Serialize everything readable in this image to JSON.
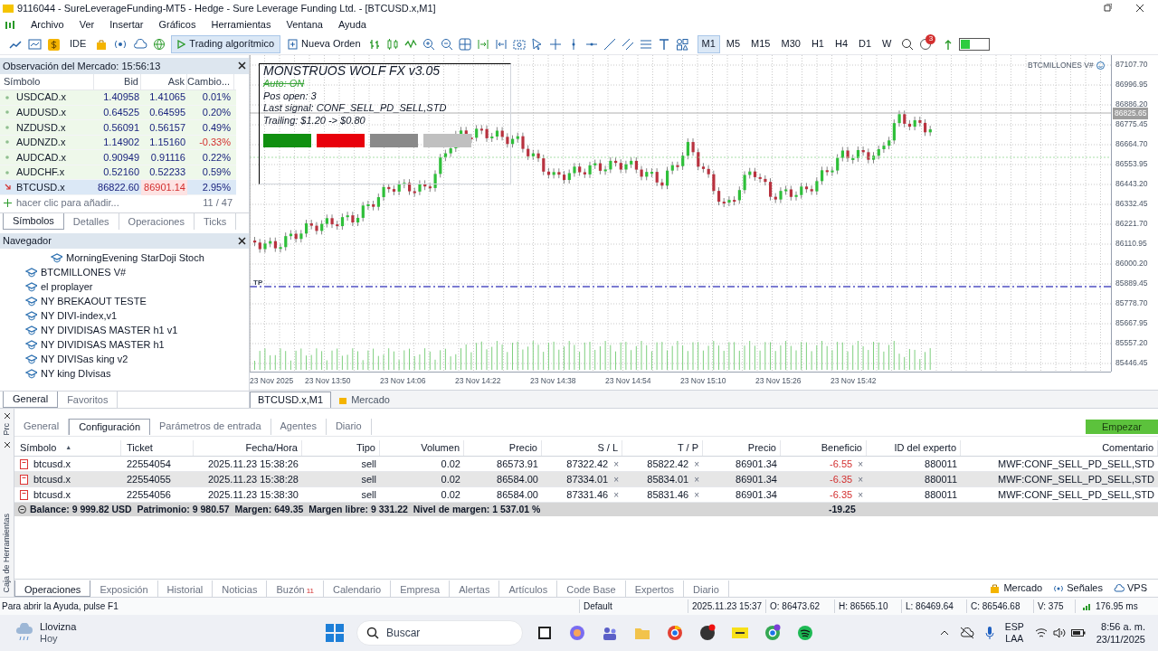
{
  "window": {
    "title": "9116044 - SureLeverageFunding-MT5 - Hedge - Sure Leverage Funding Ltd. - [BTCUSD.x,M1]"
  },
  "menu": [
    "Archivo",
    "Ver",
    "Insertar",
    "Gráficos",
    "Herramientas",
    "Ventana",
    "Ayuda"
  ],
  "toolbar": {
    "ide": "IDE",
    "algo_trading": {
      "label": "Trading algorítmico",
      "on": true
    },
    "new_order": "Nueva Orden",
    "timeframes": [
      {
        "label": "M1",
        "selected": true
      },
      {
        "label": "M5",
        "selected": false
      },
      {
        "label": "M15",
        "selected": false
      },
      {
        "label": "M30",
        "selected": false
      },
      {
        "label": "H1",
        "selected": false
      },
      {
        "label": "H4",
        "selected": false
      },
      {
        "label": "D1",
        "selected": false
      },
      {
        "label": "W",
        "selected": false
      }
    ],
    "notification_count": "3"
  },
  "market_watch": {
    "title": "Observación del Mercado: 15:56:13",
    "columns": [
      "Símbolo",
      "Bid",
      "Ask",
      "Cambio..."
    ],
    "rows": [
      {
        "symbol": "USDCAD.x",
        "bid": "1.40958",
        "ask": "1.41065",
        "change": "0.01%",
        "kind": "flat",
        "negative": false,
        "ask_falling": false,
        "selected": false
      },
      {
        "symbol": "AUDUSD.x",
        "bid": "0.64525",
        "ask": "0.64595",
        "change": "0.20%",
        "kind": "flat",
        "negative": false,
        "ask_falling": false,
        "selected": false
      },
      {
        "symbol": "NZDUSD.x",
        "bid": "0.56091",
        "ask": "0.56157",
        "change": "0.49%",
        "kind": "flat",
        "negative": false,
        "ask_falling": false,
        "selected": false
      },
      {
        "symbol": "AUDNZD.x",
        "bid": "1.14902",
        "ask": "1.15160",
        "change": "-0.33%",
        "kind": "flat",
        "negative": true,
        "ask_falling": false,
        "selected": false
      },
      {
        "symbol": "AUDCAD.x",
        "bid": "0.90949",
        "ask": "0.91116",
        "change": "0.22%",
        "kind": "flat",
        "negative": false,
        "ask_falling": false,
        "selected": false
      },
      {
        "symbol": "AUDCHF.x",
        "bid": "0.52160",
        "ask": "0.52233",
        "change": "0.59%",
        "kind": "flat",
        "negative": false,
        "ask_falling": false,
        "selected": false
      },
      {
        "symbol": "BTCUSD.x",
        "bid": "86822.60",
        "ask": "86901.14",
        "change": "2.95%",
        "kind": "down",
        "negative": false,
        "ask_falling": true,
        "selected": true
      }
    ],
    "add_hint": "hacer clic para añadir...",
    "count": "11 / 47",
    "tabs": [
      {
        "label": "Símbolos",
        "selected": true
      },
      {
        "label": "Detalles",
        "selected": false
      },
      {
        "label": "Operaciones",
        "selected": false
      },
      {
        "label": "Ticks",
        "selected": false
      }
    ]
  },
  "navigator": {
    "title": "Navegador",
    "items": [
      {
        "children": [
          {
            "label": "MorningEvening StarDoji Stoch"
          }
        ]
      },
      {
        "label": "BTCMILLONES V#"
      },
      {
        "label": "el proplayer"
      },
      {
        "label": "NY BREKAOUT TESTE"
      },
      {
        "label": "NY DIVI-index,v1"
      },
      {
        "label": "NY DIVIDISAS MASTER h1 v1"
      },
      {
        "label": "NY DIVIDISAS MASTER h1"
      },
      {
        "label": "NY DIVISas king v2"
      },
      {
        "label": "NY king DIvisas"
      }
    ],
    "tabs": [
      {
        "label": "General",
        "selected": true
      },
      {
        "label": "Favoritos",
        "selected": false
      }
    ]
  },
  "chart": {
    "ea_label": "BTCMILLONES V#",
    "panel": {
      "title": "MONSTRUOS WOLF FX v3.05",
      "auto": "Auto: ON",
      "positions": "Pos open: 3",
      "last_signal": "Last signal: CONF_SELL_PD_SELL,STD",
      "trailing": "Trailing: $1.20 -> $0.80"
    },
    "tp_label": "TP",
    "current_price": "86825.65",
    "price_labels": [
      "87107.70",
      "86996.95",
      "86886.20",
      "86775.45",
      "86664.70",
      "86553.95",
      "86443.20",
      "86332.45",
      "86221.70",
      "86110.95",
      "86000.20",
      "85889.45",
      "85778.70",
      "85667.95",
      "85557.20",
      "85446.45"
    ],
    "time_labels": [
      "23 Nov 2025",
      "23 Nov 13:50",
      "23 Nov 14:06",
      "23 Nov 14:22",
      "23 Nov 14:38",
      "23 Nov 14:54",
      "23 Nov 15:10",
      "23 Nov 15:26",
      "23 Nov 15:42"
    ],
    "tabs": [
      {
        "label": "BTCUSD.x,M1",
        "selected": true
      },
      {
        "label": "Mercado",
        "selected": false
      }
    ]
  },
  "tester": {
    "side_label": "Prc",
    "tabs": [
      {
        "label": "General",
        "selected": false
      },
      {
        "label": "Configuración",
        "selected": true
      },
      {
        "label": "Parámetros de entrada",
        "selected": false
      },
      {
        "label": "Agentes",
        "selected": false
      },
      {
        "label": "Diario",
        "selected": false
      }
    ],
    "start_button": "Empezar"
  },
  "trades": {
    "sort_mark": "▲",
    "columns": [
      "Símbolo",
      "Ticket",
      "Fecha/Hora",
      "Tipo",
      "Volumen",
      "Precio",
      "S / L",
      "T / P",
      "Precio",
      "Beneficio",
      "ID del experto",
      "Comentario"
    ],
    "rows": [
      {
        "cells": [
          "btcusd.x",
          "22554054",
          "2025.11.23 15:38:26",
          "sell",
          "0.02",
          "86573.91",
          "87322.42",
          "85822.42",
          "86901.34",
          "-6.55",
          "880011",
          "MWF:CONF_SELL_PD_SELL,STD"
        ],
        "selected": false
      },
      {
        "cells": [
          "btcusd.x",
          "22554055",
          "2025.11.23 15:38:28",
          "sell",
          "0.02",
          "86584.00",
          "87334.01",
          "85834.01",
          "86901.34",
          "-6.35",
          "880011",
          "MWF:CONF_SELL_PD_SELL,STD"
        ],
        "selected": true
      },
      {
        "cells": [
          "btcusd.x",
          "22554056",
          "2025.11.23 15:38:30",
          "sell",
          "0.02",
          "86584.00",
          "87331.46",
          "85831.46",
          "86901.34",
          "-6.35",
          "880011",
          "MWF:CONF_SELL_PD_SELL,STD"
        ],
        "selected": false
      }
    ],
    "remove_mark": "×",
    "summary": "Balance: 9 999.82 USD  Patrimonio: 9 980.57  Margen: 649.35  Margen libre: 9 331.22  Nivel de margen: 1 537.01 %",
    "total": "-19.25"
  },
  "toolbox": {
    "side_label": "Caja de Herramientas",
    "tabs": [
      {
        "label": "Operaciones",
        "selected": true
      },
      {
        "label": "Exposición",
        "selected": false
      },
      {
        "label": "Historial",
        "selected": false
      },
      {
        "label": "Noticias",
        "selected": false
      },
      {
        "label": "Buzón",
        "badge": "11",
        "selected": false
      },
      {
        "label": "Calendario",
        "selected": false
      },
      {
        "label": "Empresa",
        "selected": false
      },
      {
        "label": "Alertas",
        "selected": false
      },
      {
        "label": "Artículos",
        "selected": false
      },
      {
        "label": "Code Base",
        "selected": false
      },
      {
        "label": "Expertos",
        "selected": false
      },
      {
        "label": "Diario",
        "selected": false
      }
    ],
    "links": [
      "Mercado",
      "Señales",
      "VPS"
    ]
  },
  "status_bar": {
    "help": "Para abrir la Ayuda, pulse F1",
    "profile": "Default",
    "time": "2025.11.23 15:37",
    "open": "O: 86473.62",
    "high": "H: 86565.10",
    "low": "L: 86469.64",
    "close": "C: 86546.68",
    "volume": "V: 375",
    "ping": "176.95 ms"
  },
  "taskbar": {
    "weather": "Llovizna",
    "weather_sub": "Hoy",
    "search": {
      "placeholder": "Buscar"
    },
    "lang": "ESP",
    "layout": "LAA",
    "clock": "8:56 a. m.",
    "date": "23/11/2025"
  }
}
